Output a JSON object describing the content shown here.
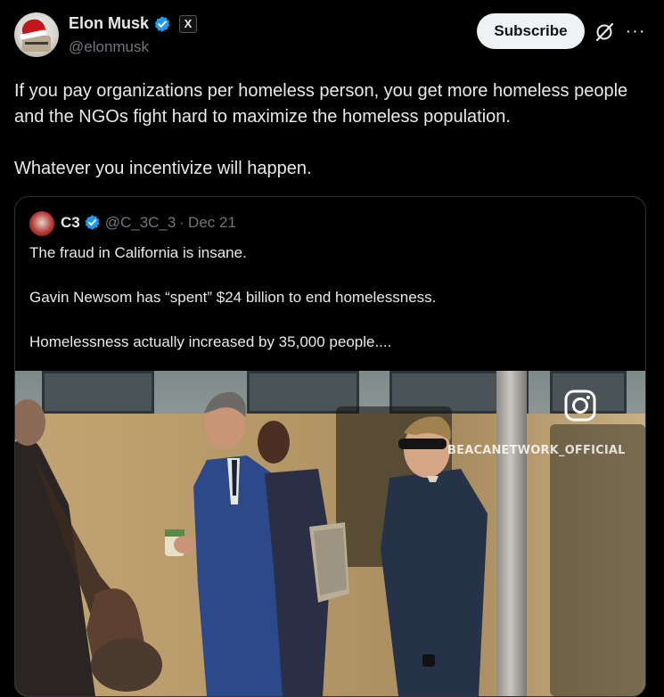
{
  "author": {
    "display_name": "Elon Musk",
    "handle": "@elonmusk",
    "badge_x": "X"
  },
  "actions": {
    "subscribe_label": "Subscribe",
    "more_label": "···"
  },
  "post": {
    "paragraph1": "If you pay organizations per homeless person, you get more homeless people and the NGOs fight hard to maximize the homeless population.",
    "paragraph2": "Whatever you incentivize will happen."
  },
  "quote": {
    "name": "C3",
    "handle": "@C_3C_3",
    "separator": "·",
    "date": "Dec 21",
    "line1": "The fraud in California is insane.",
    "line2": "Gavin Newsom has “spent” $24 billion to end homelessness.",
    "line3": "Homelessness actually increased by 35,000 people....",
    "media_watermark": "BEACANETWORK_OFFICIAL"
  },
  "colors": {
    "background": "#000000",
    "text_primary": "#e7e9ea",
    "text_secondary": "#71767b",
    "verified_blue": "#1d9bf0",
    "button_bg": "#eff3f4",
    "border": "#2f3336"
  },
  "icons": {
    "verified": "verified-check-icon",
    "grok": "grok-icon",
    "more": "more-icon",
    "instagram": "instagram-icon"
  }
}
